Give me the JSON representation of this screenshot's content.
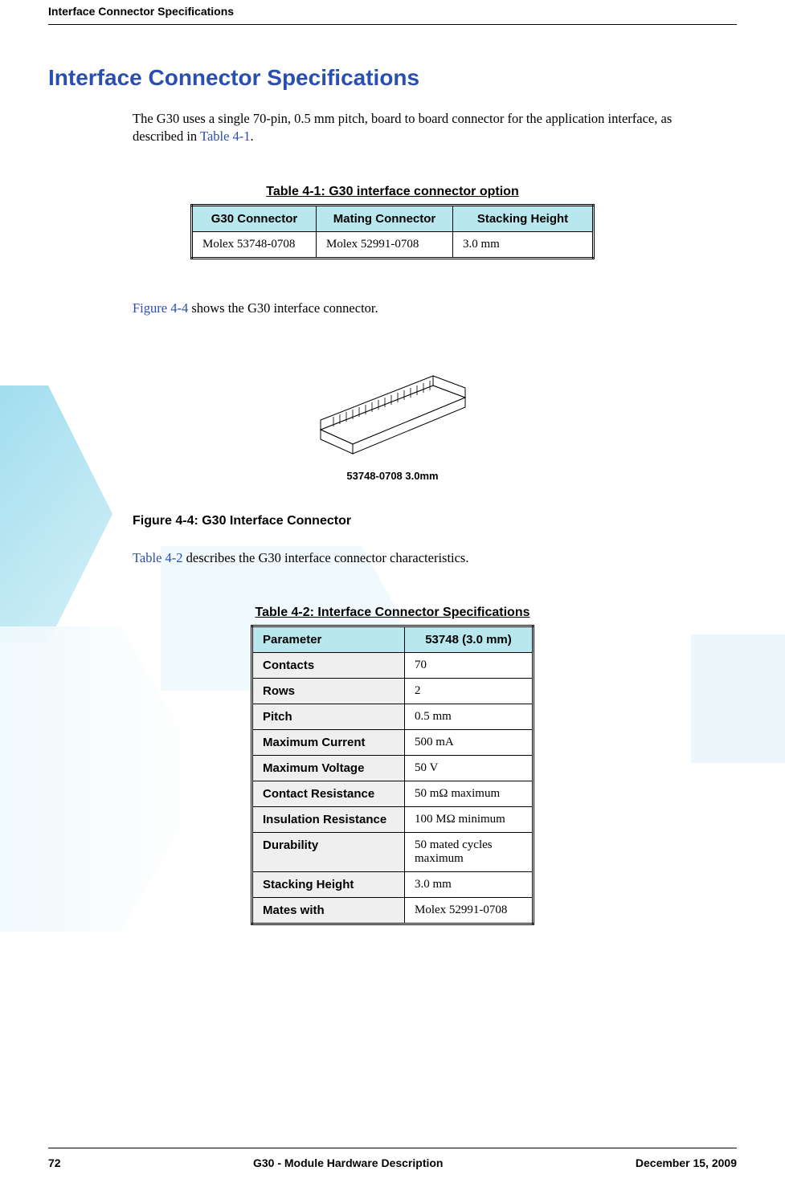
{
  "header": {
    "running_title": "Interface Connector Specifications"
  },
  "title": "Interface Connector Specifications",
  "para1_a": "The G30 uses a single 70-pin, 0.5 mm pitch, board to board connector for the application interface, as described in ",
  "para1_link": "Table 4-1",
  "para1_b": ".",
  "table1": {
    "caption": "Table 4-1: G30 interface connector option",
    "headers": [
      "G30 Connector",
      "Mating Connector",
      "Stacking Height"
    ],
    "row": [
      "Molex 53748-0708",
      "Molex 52991-0708",
      "3.0 mm"
    ]
  },
  "para2_link": "Figure 4-4",
  "para2_b": " shows the G30 interface connector.",
  "figure": {
    "label": "53748-0708 3.0mm",
    "caption": "Figure 4-4: G30 Interface Connector"
  },
  "para3_link": "Table 4-2",
  "para3_b": " describes the G30 interface connector characteristics.",
  "table2": {
    "caption": "Table 4-2: Interface Connector Specifications",
    "headers": [
      "Parameter",
      "53748 (3.0 mm)"
    ],
    "rows": [
      {
        "param": "Contacts",
        "val": "70"
      },
      {
        "param": "Rows",
        "val": "2"
      },
      {
        "param": "Pitch",
        "val": "0.5 mm"
      },
      {
        "param": "Maximum Current",
        "val": "500 mA"
      },
      {
        "param": "Maximum Voltage",
        "val": "50 V"
      },
      {
        "param": "Contact Resistance",
        "val": "50 mΩ maximum"
      },
      {
        "param": "Insulation Resistance",
        "val": "100 MΩ minimum"
      },
      {
        "param": "Durability",
        "val": "50 mated cycles maximum"
      },
      {
        "param": "Stacking Height",
        "val": "3.0 mm"
      },
      {
        "param": "Mates with",
        "val": "Molex 52991-0708"
      }
    ]
  },
  "footer": {
    "page": "72",
    "doc": "G30 - Module Hardware Description",
    "date": "December 15, 2009"
  }
}
